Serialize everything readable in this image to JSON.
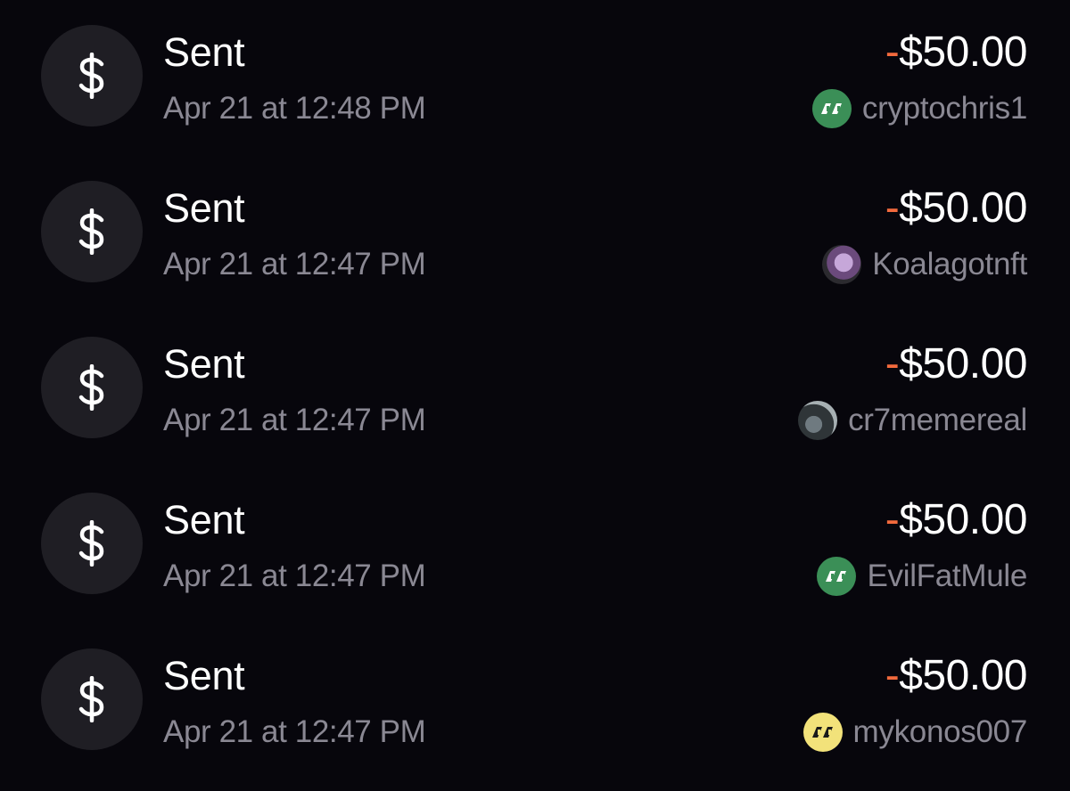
{
  "transactions": [
    {
      "title": "Sent",
      "date": "Apr 21 at 12:48 PM",
      "amount_sign": "-",
      "amount_value": "$50.00",
      "recipient": "cryptochris1",
      "avatar_style": "green-logo-icon"
    },
    {
      "title": "Sent",
      "date": "Apr 21 at 12:47 PM",
      "amount_sign": "-",
      "amount_value": "$50.00",
      "recipient": "Koalagotnft",
      "avatar_style": "profile-photo"
    },
    {
      "title": "Sent",
      "date": "Apr 21 at 12:47 PM",
      "amount_sign": "-",
      "amount_value": "$50.00",
      "recipient": "cr7memereal",
      "avatar_style": "profile-photo"
    },
    {
      "title": "Sent",
      "date": "Apr 21 at 12:47 PM",
      "amount_sign": "-",
      "amount_value": "$50.00",
      "recipient": "EvilFatMule",
      "avatar_style": "green-logo-icon"
    },
    {
      "title": "Sent",
      "date": "Apr 21 at 12:47 PM",
      "amount_sign": "-",
      "amount_value": "$50.00",
      "recipient": "mykonos007",
      "avatar_style": "yellow-logo-icon"
    }
  ],
  "icons": {
    "transaction_type": "dollar-icon"
  },
  "colors": {
    "background": "#07060c",
    "icon_circle": "#1f1e24",
    "primary_text": "#ffffff",
    "secondary_text": "#8a8893",
    "negative_sign": "#f26a3d",
    "green_avatar": "#3b8f57",
    "yellow_avatar": "#f2e27a"
  }
}
